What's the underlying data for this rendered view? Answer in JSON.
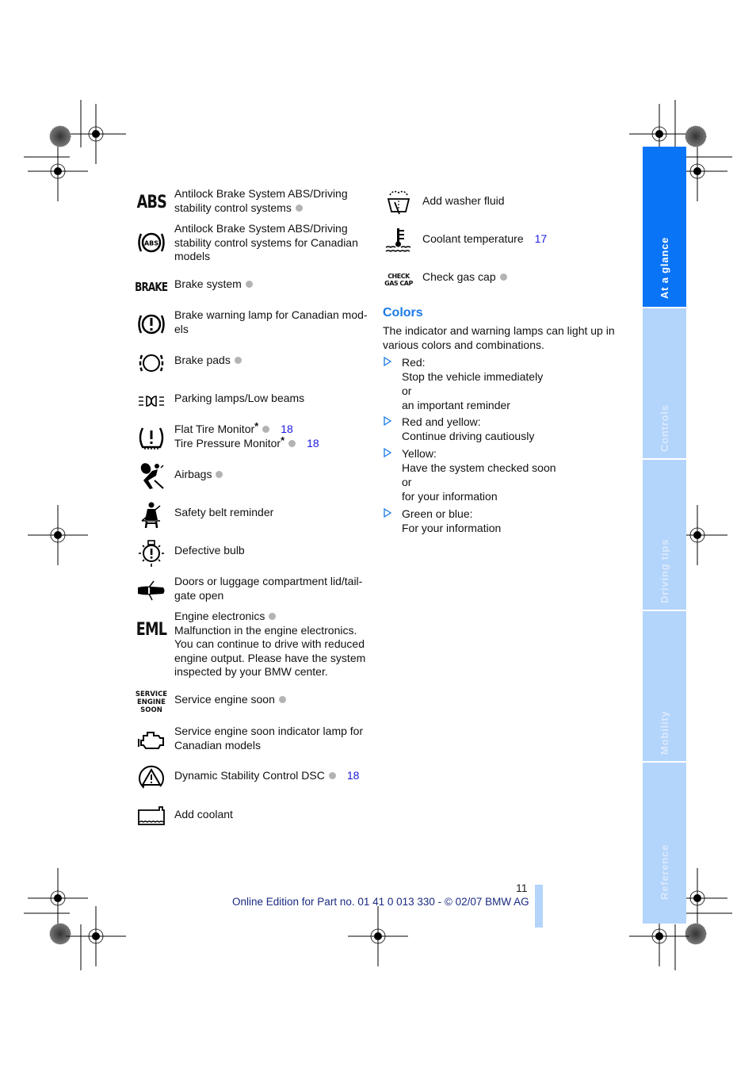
{
  "left_column": {
    "items": [
      {
        "icon": "abs-icon",
        "icon_text": "ABS",
        "lines": [
          "Antilock Brake System ABS/Driving",
          "stability control systems"
        ],
        "dot": true
      },
      {
        "icon": "abs-circle-icon",
        "icon_text": "ABS",
        "lines": [
          "Antilock Brake System ABS/Driving",
          "stability control systems for Canadian",
          "models"
        ],
        "dot": false
      },
      {
        "icon": "brake-text-icon",
        "icon_text": "BRAKE",
        "lines": [
          "Brake system"
        ],
        "dot": true
      },
      {
        "icon": "brake-warning-icon",
        "icon_text": "",
        "lines": [
          "Brake warning lamp for Canadian mod-",
          "els"
        ],
        "dot": false
      },
      {
        "icon": "brake-pads-icon",
        "icon_text": "",
        "lines": [
          "Brake pads"
        ],
        "dot": true
      },
      {
        "icon": "parking-lamps-icon",
        "icon_text": "",
        "lines": [
          "Parking lamps/Low beams"
        ],
        "dot": false
      },
      {
        "icon": "tire-monitor-icon",
        "icon_text": "",
        "lines": [
          "Flat Tire Monitor",
          "Tire Pressure Monitor"
        ],
        "asterisk": "*",
        "refs": [
          "18",
          "18"
        ],
        "dot": true
      },
      {
        "icon": "airbag-icon",
        "icon_text": "",
        "lines": [
          "Airbags"
        ],
        "dot": true
      },
      {
        "icon": "seat-belt-icon",
        "icon_text": "",
        "lines": [
          "Safety belt reminder"
        ],
        "dot": false
      },
      {
        "icon": "defective-bulb-icon",
        "icon_text": "",
        "lines": [
          "Defective bulb"
        ],
        "dot": false
      },
      {
        "icon": "door-open-icon",
        "icon_text": "",
        "lines": [
          "Doors or luggage compartment lid/tail-",
          "gate open"
        ],
        "dot": false
      },
      {
        "icon": "eml-icon",
        "icon_text": "EML",
        "lines": [
          "Engine electronics",
          "Malfunction in the engine electronics.",
          "You can continue to drive with reduced",
          "engine output. Please have the system",
          "inspected by your BMW center."
        ],
        "dot": true
      },
      {
        "icon": "service-engine-soon-icon",
        "icon_text": [
          "SERVICE",
          "ENGINE",
          "SOON"
        ],
        "lines": [
          "Service engine soon"
        ],
        "dot": true
      },
      {
        "icon": "engine-icon",
        "icon_text": "",
        "lines": [
          "Service engine soon indicator lamp for",
          "Canadian models"
        ],
        "dot": false
      },
      {
        "icon": "dsc-icon",
        "icon_text": "",
        "lines": [
          "Dynamic Stability Control DSC"
        ],
        "refs": [
          "18"
        ],
        "dot": true
      },
      {
        "icon": "add-coolant-icon",
        "icon_text": "",
        "lines": [
          "Add coolant"
        ],
        "dot": false
      }
    ]
  },
  "right_column": {
    "items": [
      {
        "icon": "washer-fluid-icon",
        "lines": [
          "Add washer fluid"
        ],
        "dot": false
      },
      {
        "icon": "coolant-temperature-icon",
        "lines": [
          "Coolant temperature"
        ],
        "refs": [
          "17"
        ],
        "dot": false
      },
      {
        "icon": "check-gas-cap-icon",
        "icon_text": [
          "CHECK",
          "GAS CAP"
        ],
        "lines": [
          "Check gas cap"
        ],
        "dot": true
      }
    ],
    "colors": {
      "title": "Colors",
      "intro": [
        "The indicator and warning lamps can light up in",
        "various colors and combinations."
      ],
      "bullets": [
        {
          "lines": [
            "Red:",
            "Stop the vehicle immediately",
            "or",
            "an important reminder"
          ]
        },
        {
          "lines": [
            "Red and yellow:",
            "Continue driving cautiously"
          ]
        },
        {
          "lines": [
            "Yellow:",
            "Have the system checked soon",
            "or",
            "for your information"
          ]
        },
        {
          "lines": [
            "Green or blue:",
            "For your information"
          ]
        }
      ]
    }
  },
  "side_tabs": [
    {
      "label": "At a glance",
      "active": true
    },
    {
      "label": "Controls",
      "active": false
    },
    {
      "label": "Driving tips",
      "active": false
    },
    {
      "label": "Mobility",
      "active": false
    },
    {
      "label": "Reference",
      "active": false
    }
  ],
  "footer": {
    "page_number": "11",
    "text": "Online Edition for Part no. 01 41 0 013 330 - © 02/07 BMW AG"
  },
  "colors": {
    "accent": "#0a74f7",
    "tab_inactive": "#b3d4fb",
    "heading": "#1a7ae6",
    "link": "#1a1adf",
    "dot": "#b3b3b3"
  }
}
